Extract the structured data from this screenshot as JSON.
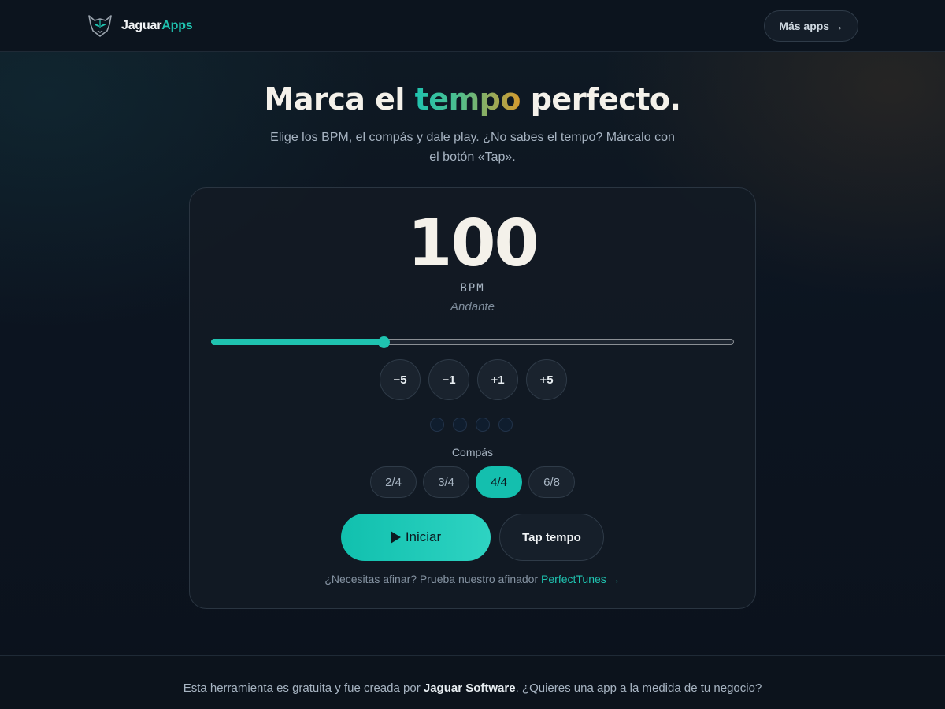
{
  "header": {
    "brand_part1": "Jaguar",
    "brand_part2": "Apps",
    "logo_icon": "jaguar-head-logo",
    "more_apps_label": "Más apps →"
  },
  "hero": {
    "title_before": "Marca el ",
    "title_highlight": "tempo",
    "title_after": " perfecto.",
    "subtitle": "Elige los BPM, el compás y dale play. ¿No sabes el tempo? Márcalo con el botón «Tap»."
  },
  "metronome": {
    "bpm": "100",
    "bpm_unit": "BPM",
    "tempo_name": "Andante",
    "slider_fraction": 0.33,
    "step_buttons": [
      "−5",
      "−1",
      "+1",
      "+5"
    ],
    "beats_count": 4,
    "compas_label": "Compás",
    "meters": [
      "2/4",
      "3/4",
      "4/4",
      "6/8"
    ],
    "active_meter": "4/4",
    "start_label": "Iniciar",
    "tap_label": "Tap tempo",
    "tuner_text": "¿Necesitas afinar? Prueba nuestro afinador ",
    "tuner_link": "PerfectTunes →"
  },
  "footer": {
    "text_before": "Esta herramienta es gratuita y fue creada por ",
    "company": "Jaguar Software",
    "text_after": ". ¿Quieres una app a la medida de tu negocio?"
  },
  "colors": {
    "accent": "#1fc3b0",
    "background": "#0d1520",
    "title_gradient_end": "#d59a2e"
  }
}
